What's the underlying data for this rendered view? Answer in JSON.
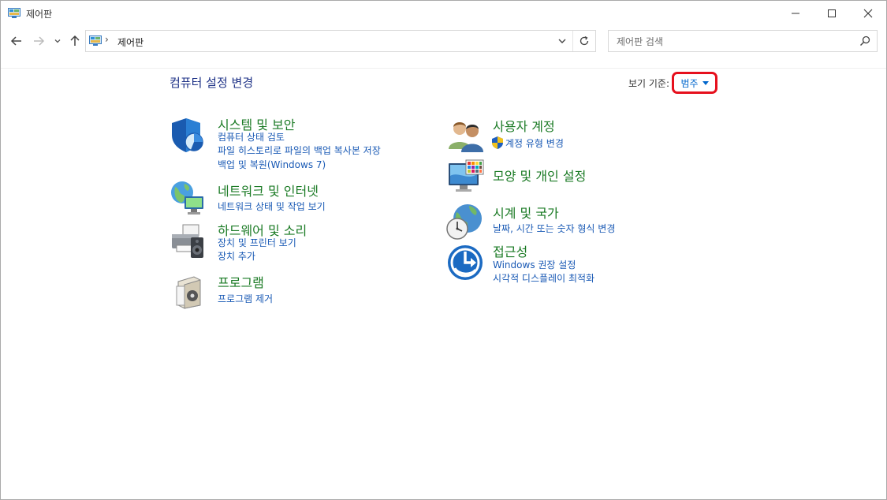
{
  "window": {
    "title": "제어판",
    "icon": "control-panel-icon",
    "buttons": [
      "minimize-icon",
      "maximize-icon",
      "close-icon"
    ]
  },
  "navigation": {
    "back_icon": "arrow-left-icon",
    "forward_icon": "arrow-right-icon",
    "recent_icon": "chevron-down-icon",
    "up_icon": "arrow-up-icon"
  },
  "address_bar": {
    "separator": "›",
    "path": "제어판",
    "refresh_icon": "refresh-icon"
  },
  "search": {
    "placeholder": "제어판 검색",
    "value": ""
  },
  "main": {
    "title": "컴퓨터 설정 변경",
    "view_by": {
      "label": "보기 기준:",
      "selected": "범주"
    }
  },
  "categories": {
    "system": {
      "title": "시스템 및 보안",
      "icon": "security-shield-icon",
      "links": [
        "컴퓨터 상태 검토",
        "파일 히스토리로 파일의 백업 복사본 저장",
        "백업 및 복원(Windows 7)"
      ]
    },
    "network": {
      "title": "네트워크 및 인터넷",
      "icon": "network-globe-icon",
      "links": [
        "네트워크 상태 및 작업 보기"
      ]
    },
    "hardware": {
      "title": "하드웨어 및 소리",
      "icon": "printer-speaker-icon",
      "links": [
        "장치 및 프린터 보기",
        "장치 추가"
      ]
    },
    "programs": {
      "title": "프로그램",
      "icon": "programs-box-icon",
      "links": [
        "프로그램 제거"
      ]
    },
    "users": {
      "title": "사용자 계정",
      "icon": "users-icon",
      "links": [
        "계정 유형 변경"
      ]
    },
    "appearance": {
      "title": "모양 및 개인 설정",
      "icon": "monitor-colors-icon",
      "links": []
    },
    "clock": {
      "title": "시계 및 국가",
      "icon": "clock-globe-icon",
      "links": [
        "날짜, 시간 또는 숫자 형식 변경"
      ]
    },
    "ease": {
      "title": "접근성",
      "icon": "ease-of-access-icon",
      "links": [
        "Windows 권장 설정",
        "시각적 디스플레이 최적화"
      ]
    }
  },
  "colors": {
    "category_title": "#1a7a24",
    "link": "#1a5ab5",
    "page_title": "#1e3287",
    "highlight_border": "#e6101d"
  }
}
